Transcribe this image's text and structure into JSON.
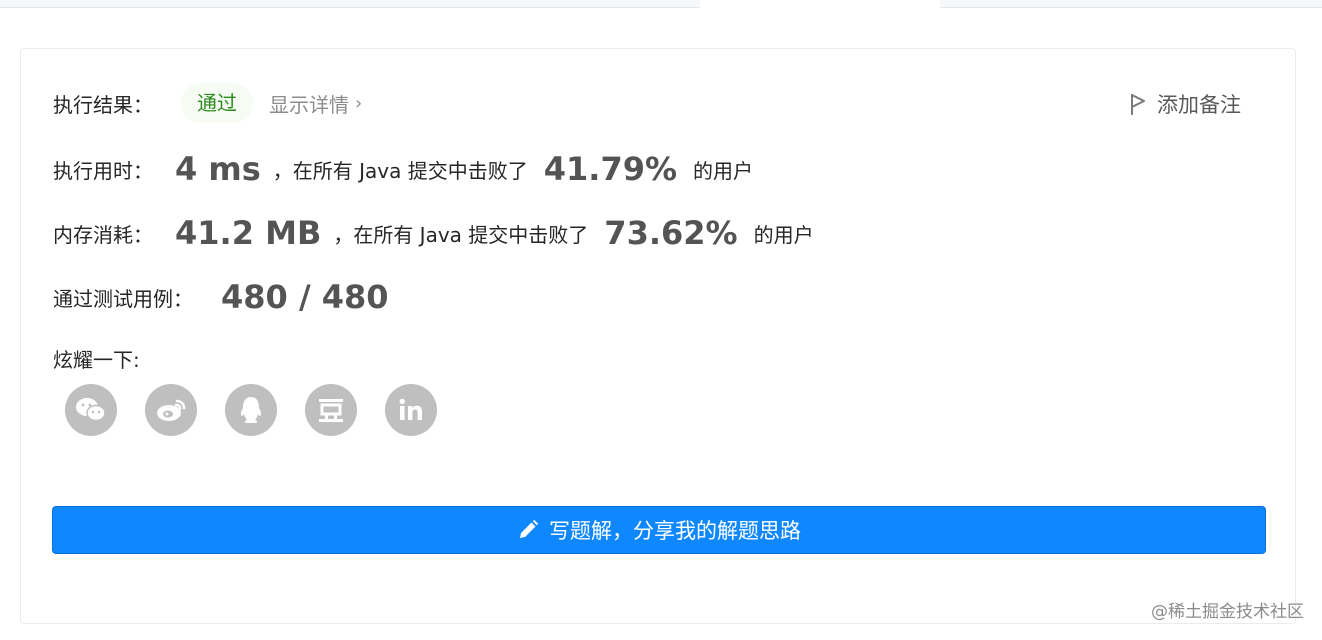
{
  "result": {
    "label": "执行结果：",
    "status": "通过",
    "details_link": "显示详情",
    "add_note": "添加备注"
  },
  "runtime": {
    "label": "执行用时：",
    "value": "4 ms",
    "text_before": "，在所有 Java 提交中击败了",
    "percent": "41.79%",
    "text_after": "的用户"
  },
  "memory": {
    "label": "内存消耗：",
    "value": "41.2 MB",
    "text_before": "，在所有 Java 提交中击败了",
    "percent": "73.62%",
    "text_after": "的用户"
  },
  "testcases": {
    "label": "通过测试用例：",
    "value": "480 / 480"
  },
  "share": {
    "label": "炫耀一下:",
    "icons": [
      "wechat-icon",
      "weibo-icon",
      "qq-icon",
      "douban-icon",
      "linkedin-icon"
    ]
  },
  "write_button": {
    "label": "写题解，分享我的解题思路"
  },
  "watermark": "@稀土掘金技术社区",
  "colors": {
    "accent": "#0f88ff",
    "status_bg": "#f6fbf3",
    "status_text": "#2d8a1e",
    "icon_gray": "#bfbfbf"
  }
}
